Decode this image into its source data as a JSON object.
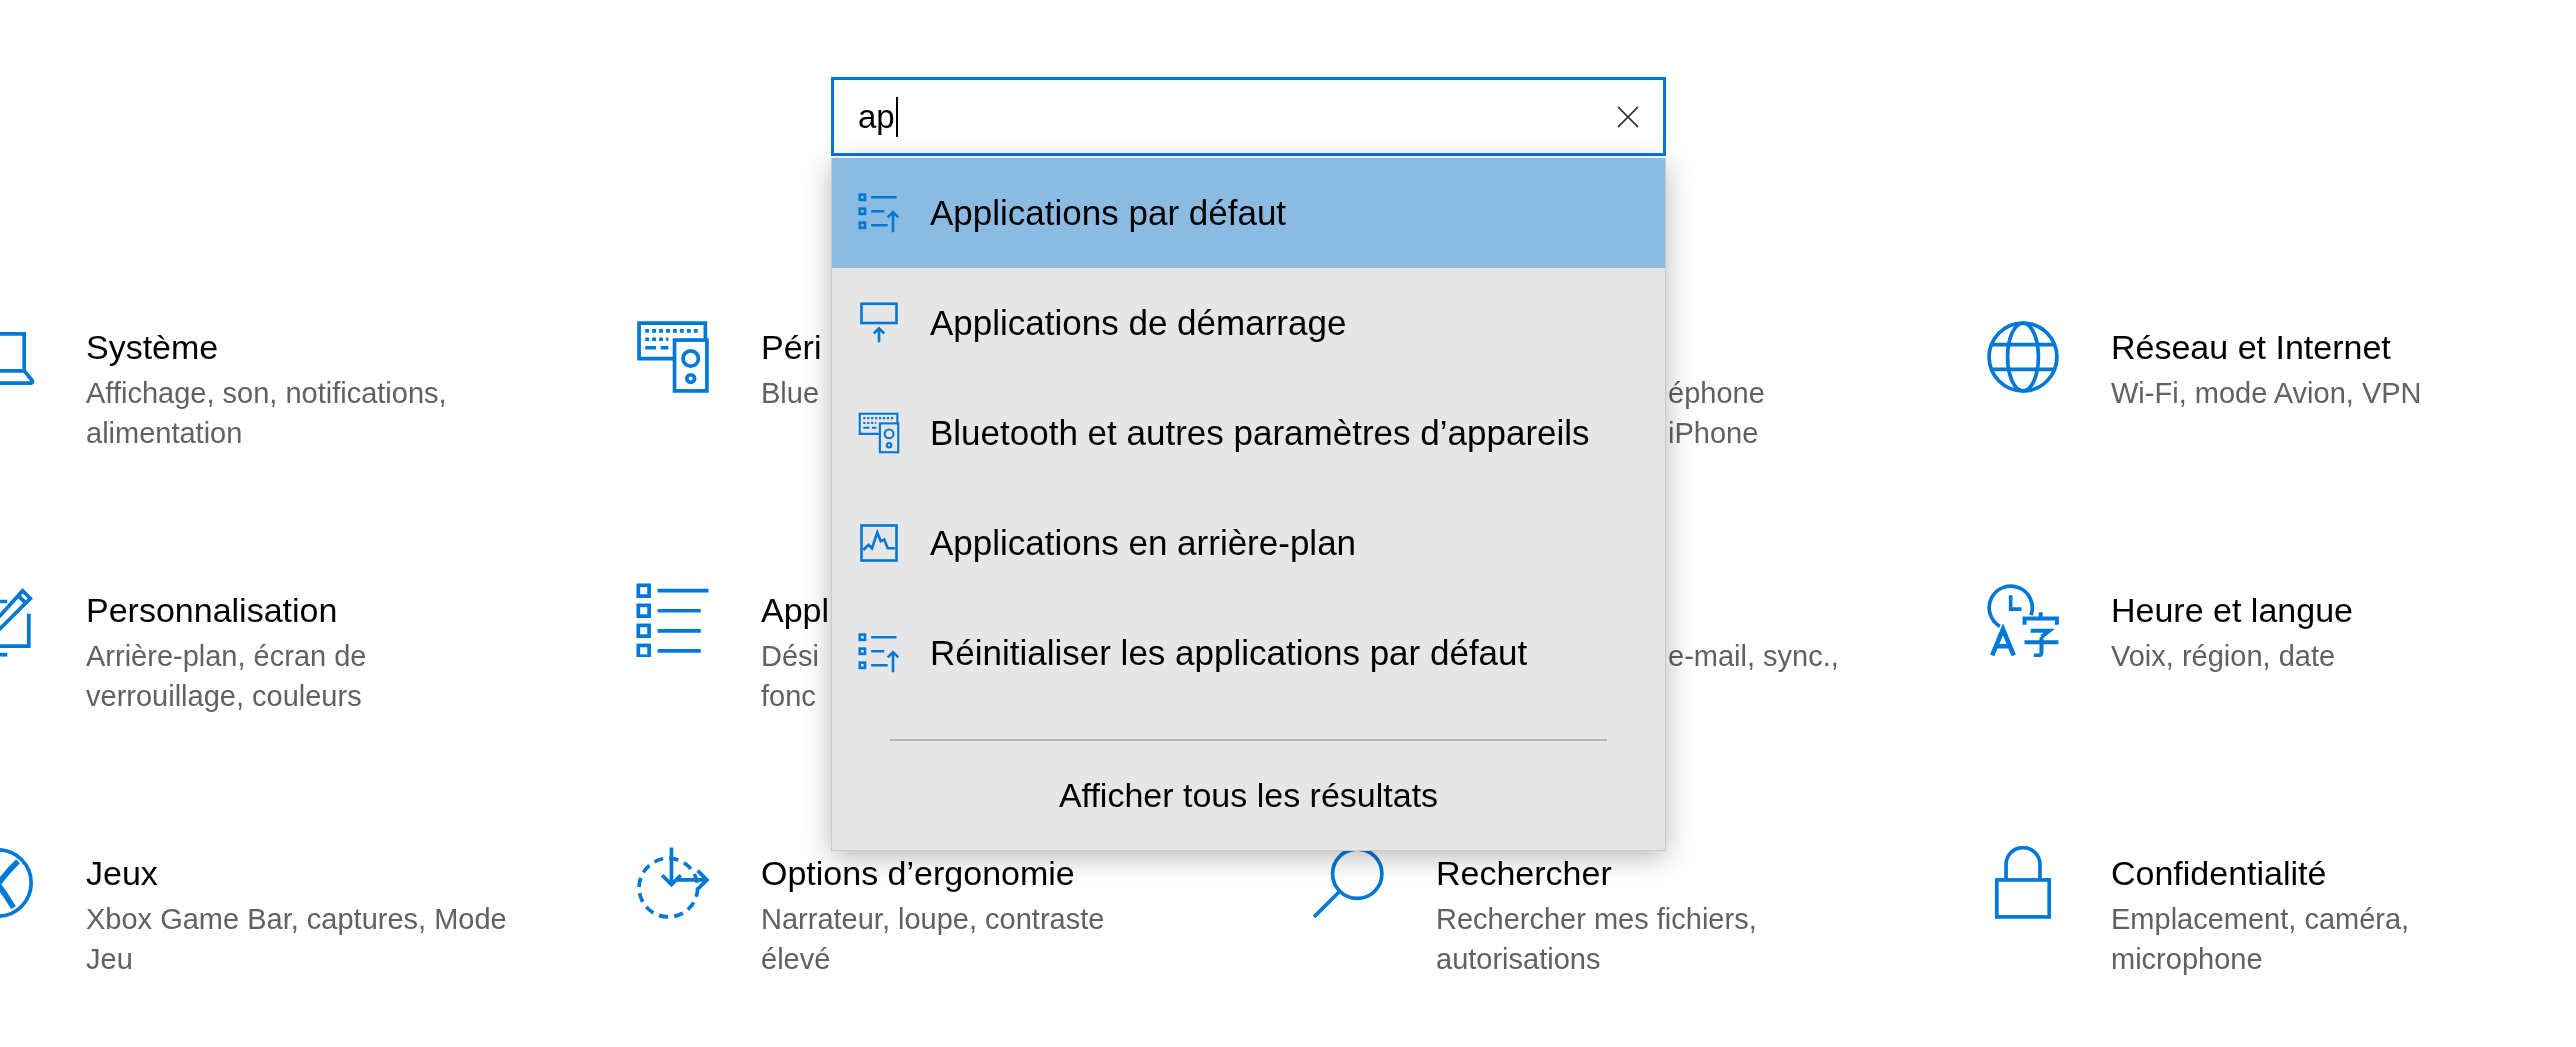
{
  "search": {
    "value": "ap",
    "results": [
      {
        "label": "Applications par défaut",
        "selected": true
      },
      {
        "label": "Applications de démarrage",
        "selected": false
      },
      {
        "label": "Bluetooth et autres paramètres d’appareils",
        "selected": false
      },
      {
        "label": "Applications en arrière-plan",
        "selected": false
      },
      {
        "label": "Réinitialiser les applications par défaut",
        "selected": false
      }
    ],
    "show_all": "Afficher tous les résultats"
  },
  "tiles": [
    {
      "kind": "full",
      "title": "Système",
      "description": "Affichage, son, notifications,\nalimentation"
    },
    {
      "kind": "full",
      "title": "Péri",
      "description": "Blue"
    },
    {
      "kind": "covered",
      "description": "éphone\niPhone"
    },
    {
      "kind": "full",
      "title": "Réseau et Internet",
      "description": "Wi-Fi, mode Avion, VPN"
    },
    {
      "kind": "full",
      "title": "Personnalisation",
      "description": "Arrière-plan, écran de\nverrouillage, couleurs"
    },
    {
      "kind": "full",
      "title": "Appl",
      "description": "Dési\nfonc"
    },
    {
      "kind": "covered",
      "description": "e-mail, sync.,"
    },
    {
      "kind": "full",
      "title": "Heure et langue",
      "description": "Voix, région, date"
    },
    {
      "kind": "full",
      "title": "Jeux",
      "description": "Xbox Game Bar, captures, Mode\nJeu"
    },
    {
      "kind": "full",
      "title": "Options d’ergonomie",
      "description": "Narrateur, loupe, contraste\nélevé"
    },
    {
      "kind": "full",
      "title": "Rechercher",
      "description": "Rechercher mes fichiers,\nautorisations"
    },
    {
      "kind": "full",
      "title": "Confidentialité",
      "description": "Emplacement, caméra,\nmicrophone"
    }
  ]
}
